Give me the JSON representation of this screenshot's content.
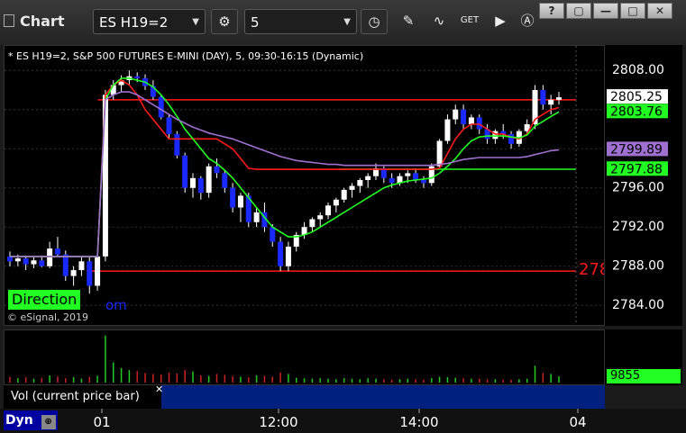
{
  "titlebar": {
    "app_title": "Chart",
    "symbol": "ES H19=2",
    "interval": "5",
    "buttons": [
      "?",
      "▢",
      "—",
      "□",
      "✕"
    ]
  },
  "chart_header": "* ES H19=2, S&P 500 FUTURES E-MINI (DAY), 5, 09:30-16:15 (Dynamic)",
  "direction_label": "Direction",
  "copyright": "© eSignal, 2019",
  "partial_label": "om",
  "red_partial_label": "278",
  "vol_label": "Vol (current price bar)",
  "vol_close": "✕",
  "vol_value": "9855",
  "dyn_label": "Dyn",
  "colors": {
    "up_candle": "#ffffff",
    "down_candle": "#1a2aff",
    "red_line": "#ff1a1a",
    "green_line": "#22ff22",
    "purple_line": "#a070d0",
    "direction_bg": "#22ff22"
  },
  "chart_data": {
    "type": "line",
    "price_ticks": [
      2784.0,
      2788.0,
      2792.0,
      2796.0,
      2800.0,
      2804.0,
      2808.0
    ],
    "price_tick_labels": [
      "2808.00",
      "2796.00",
      "2792.00",
      "2788.00",
      "2784.00"
    ],
    "ylim": [
      2782.0,
      2810.5
    ],
    "time_labels": [
      "01",
      "12:00",
      "14:00",
      "04"
    ],
    "price_labels": [
      {
        "text": "2805.25",
        "value": 2805.25,
        "bg": "#ffffff",
        "fg": "#000000"
      },
      {
        "text": "2803.76",
        "value": 2803.76,
        "bg": "#22ff22",
        "fg": "#000000"
      },
      {
        "text": "2799.89",
        "value": 2799.89,
        "bg": "#a070d0",
        "fg": "#000000"
      },
      {
        "text": "2797.88",
        "value": 2797.88,
        "bg": "#22ff22",
        "fg": "#000000"
      }
    ],
    "horizontal_lines": [
      {
        "value": 2805.0,
        "color": "#ff1a1a",
        "x_start": 0.16
      },
      {
        "value": 2797.9,
        "color": "#22ff22",
        "x_start": 0.6
      },
      {
        "value": 2787.5,
        "color": "#ff1a1a",
        "x_start": 0.14
      }
    ],
    "candles": [
      [
        2789.0,
        2789.5,
        2788.0,
        2788.5
      ],
      [
        2788.5,
        2789.2,
        2788.0,
        2788.8
      ],
      [
        2788.8,
        2789.0,
        2787.6,
        2788.2
      ],
      [
        2788.2,
        2788.9,
        2787.8,
        2788.6
      ],
      [
        2788.6,
        2789.1,
        2787.9,
        2788.0
      ],
      [
        2788.0,
        2790.5,
        2787.8,
        2789.8
      ],
      [
        2789.8,
        2791.0,
        2789.0,
        2789.2
      ],
      [
        2789.2,
        2789.6,
        2786.5,
        2787.0
      ],
      [
        2787.0,
        2788.0,
        2786.0,
        2787.6
      ],
      [
        2787.6,
        2789.0,
        2787.0,
        2788.5
      ],
      [
        2788.5,
        2789.0,
        2785.2,
        2786.0
      ],
      [
        2786.0,
        2789.5,
        2785.5,
        2789.0
      ],
      [
        2789.0,
        2806.0,
        2788.5,
        2805.5
      ],
      [
        2805.5,
        2807.0,
        2805.0,
        2806.5
      ],
      [
        2806.5,
        2807.5,
        2805.8,
        2807.0
      ],
      [
        2807.0,
        2808.0,
        2806.5,
        2807.4
      ],
      [
        2807.4,
        2807.8,
        2806.8,
        2807.2
      ],
      [
        2807.2,
        2807.6,
        2806.0,
        2806.4
      ],
      [
        2806.4,
        2807.0,
        2805.0,
        2805.3
      ],
      [
        2805.3,
        2805.5,
        2803.0,
        2803.2
      ],
      [
        2803.2,
        2803.5,
        2801.0,
        2801.5
      ],
      [
        2801.5,
        2801.8,
        2799.0,
        2799.3
      ],
      [
        2799.3,
        2799.6,
        2795.5,
        2796.0
      ],
      [
        2796.0,
        2797.5,
        2795.0,
        2797.0
      ],
      [
        2797.0,
        2797.2,
        2794.8,
        2795.5
      ],
      [
        2795.5,
        2798.5,
        2795.0,
        2798.2
      ],
      [
        2798.2,
        2799.0,
        2797.0,
        2797.5
      ],
      [
        2797.5,
        2797.8,
        2795.5,
        2796.0
      ],
      [
        2796.0,
        2796.5,
        2793.5,
        2794.0
      ],
      [
        2794.0,
        2795.5,
        2792.5,
        2795.2
      ],
      [
        2795.2,
        2795.5,
        2792.0,
        2792.5
      ],
      [
        2792.5,
        2794.0,
        2792.0,
        2793.5
      ],
      [
        2793.5,
        2794.5,
        2791.5,
        2792.0
      ],
      [
        2792.0,
        2792.3,
        2790.0,
        2790.5
      ],
      [
        2790.5,
        2791.0,
        2787.5,
        2788.0
      ],
      [
        2788.0,
        2790.5,
        2787.5,
        2790.0
      ],
      [
        2790.0,
        2791.5,
        2789.5,
        2791.2
      ],
      [
        2791.2,
        2792.5,
        2790.8,
        2792.0
      ],
      [
        2792.0,
        2793.0,
        2791.5,
        2792.8
      ],
      [
        2792.8,
        2793.5,
        2792.0,
        2793.2
      ],
      [
        2793.2,
        2794.5,
        2792.8,
        2794.2
      ],
      [
        2794.2,
        2795.0,
        2793.5,
        2794.8
      ],
      [
        2794.8,
        2796.0,
        2794.5,
        2795.8
      ],
      [
        2795.8,
        2796.5,
        2795.0,
        2796.2
      ],
      [
        2796.2,
        2797.0,
        2795.5,
        2796.8
      ],
      [
        2796.8,
        2797.5,
        2796.0,
        2797.2
      ],
      [
        2797.2,
        2798.5,
        2796.8,
        2798.0
      ],
      [
        2798.0,
        2798.2,
        2796.5,
        2797.0
      ],
      [
        2797.0,
        2797.5,
        2796.0,
        2796.5
      ],
      [
        2796.5,
        2797.5,
        2796.2,
        2797.2
      ],
      [
        2797.2,
        2797.8,
        2796.5,
        2797.5
      ],
      [
        2797.5,
        2798.0,
        2796.5,
        2796.8
      ],
      [
        2796.8,
        2797.2,
        2796.0,
        2796.5
      ],
      [
        2796.5,
        2798.5,
        2796.2,
        2798.2
      ],
      [
        2798.2,
        2801.0,
        2798.0,
        2800.8
      ],
      [
        2800.8,
        2803.5,
        2800.5,
        2803.0
      ],
      [
        2803.0,
        2804.5,
        2802.5,
        2804.0
      ],
      [
        2804.0,
        2804.5,
        2802.0,
        2802.5
      ],
      [
        2802.5,
        2803.5,
        2802.0,
        2803.2
      ],
      [
        2803.2,
        2803.5,
        2801.5,
        2802.0
      ],
      [
        2802.0,
        2802.5,
        2800.5,
        2801.0
      ],
      [
        2801.0,
        2802.0,
        2800.5,
        2801.8
      ],
      [
        2801.8,
        2802.5,
        2801.0,
        2801.5
      ],
      [
        2801.5,
        2801.8,
        2800.0,
        2800.5
      ],
      [
        2800.5,
        2802.0,
        2800.2,
        2801.8
      ],
      [
        2801.8,
        2803.0,
        2801.5,
        2802.5
      ],
      [
        2802.5,
        2806.5,
        2802.0,
        2806.0
      ],
      [
        2806.0,
        2806.5,
        2804.0,
        2804.5
      ],
      [
        2804.5,
        2805.5,
        2803.5,
        2805.0
      ],
      [
        2805.0,
        2805.8,
        2804.5,
        2805.25
      ]
    ],
    "series": [
      {
        "name": "",
        "color": "#ff1a1a",
        "values": [
          2789,
          2789,
          2789,
          2789,
          2789,
          2789,
          2789,
          2789,
          2789,
          2789,
          2789,
          2789,
          2805.5,
          2806.5,
          2807.0,
          2806.5,
          2805.5,
          2804.0,
          2803.0,
          2802.0,
          2801.0,
          2801.0,
          2801.0,
          2801.0,
          2801.0,
          2801.0,
          2801.0,
          2800.5,
          2800.0,
          2799.0,
          2798.0,
          2797.9,
          2797.9,
          2797.9,
          2797.9,
          2797.9,
          2797.9,
          2797.9,
          2797.9,
          2797.9,
          2797.9,
          2797.9,
          2797.9,
          2797.9,
          2797.9,
          2797.9,
          2797.9,
          2797.9,
          2797.9,
          2797.9,
          2797.9,
          2797.9,
          2797.9,
          2797.9,
          2798.0,
          2799.5,
          2801.0,
          2802.0,
          2802.5,
          2802.5,
          2802.0,
          2801.5,
          2801.5,
          2801.2,
          2801.0,
          2801.5,
          2803.0,
          2803.5,
          2804.0,
          2804.2
        ]
      },
      {
        "name": "",
        "color": "#22ff22",
        "values": [
          2789,
          2789,
          2789,
          2789,
          2789,
          2789,
          2789,
          2789,
          2789,
          2789,
          2789,
          2789,
          2805.0,
          2806.5,
          2807.2,
          2807.2,
          2807.0,
          2806.8,
          2806.3,
          2805.5,
          2804.5,
          2803.3,
          2802.0,
          2801.0,
          2800.0,
          2799.0,
          2798.5,
          2797.8,
          2797.0,
          2796.0,
          2795.0,
          2794.0,
          2793.0,
          2792.0,
          2791.5,
          2791.0,
          2791.0,
          2791.2,
          2791.5,
          2792.0,
          2792.5,
          2793.0,
          2793.5,
          2794.0,
          2794.5,
          2795.0,
          2795.5,
          2796.0,
          2796.3,
          2796.5,
          2796.7,
          2796.8,
          2796.9,
          2797.0,
          2797.5,
          2798.2,
          2799.0,
          2800.0,
          2800.8,
          2801.2,
          2801.3,
          2801.3,
          2801.3,
          2801.2,
          2801.1,
          2801.4,
          2802.3,
          2802.8,
          2803.3,
          2803.76
        ]
      },
      {
        "name": "",
        "color": "#a070d0",
        "values": [
          2789,
          2789,
          2789,
          2789,
          2789,
          2789,
          2789,
          2789,
          2789,
          2789,
          2789,
          2789,
          2805.0,
          2805.5,
          2805.8,
          2805.8,
          2805.5,
          2805.0,
          2804.5,
          2804.0,
          2803.5,
          2803.0,
          2802.6,
          2802.2,
          2801.9,
          2801.6,
          2801.4,
          2801.2,
          2801.0,
          2800.7,
          2800.4,
          2800.1,
          2799.8,
          2799.5,
          2799.2,
          2799.0,
          2798.8,
          2798.7,
          2798.6,
          2798.5,
          2798.4,
          2798.4,
          2798.3,
          2798.3,
          2798.3,
          2798.3,
          2798.3,
          2798.3,
          2798.3,
          2798.3,
          2798.3,
          2798.3,
          2798.3,
          2798.3,
          2798.4,
          2798.5,
          2798.7,
          2798.9,
          2799.0,
          2799.1,
          2799.1,
          2799.1,
          2799.1,
          2799.1,
          2799.1,
          2799.2,
          2799.4,
          2799.6,
          2799.8,
          2799.89
        ]
      }
    ],
    "volume": [
      1200,
      900,
      1100,
      800,
      1000,
      1500,
      1300,
      900,
      1100,
      800,
      1200,
      1400,
      9800,
      4200,
      3000,
      2600,
      2400,
      2000,
      1800,
      1700,
      2100,
      1900,
      2600,
      2300,
      1500,
      1400,
      1800,
      1600,
      1300,
      1200,
      1100,
      1500,
      1400,
      1200,
      2100,
      1800,
      1000,
      900,
      800,
      900,
      800,
      700,
      900,
      800,
      700,
      900,
      800,
      700,
      600,
      700,
      800,
      700,
      600,
      900,
      1200,
      1100,
      1000,
      900,
      800,
      800,
      700,
      700,
      600,
      600,
      700,
      800,
      3500,
      2000,
      1800,
      1300
    ]
  }
}
